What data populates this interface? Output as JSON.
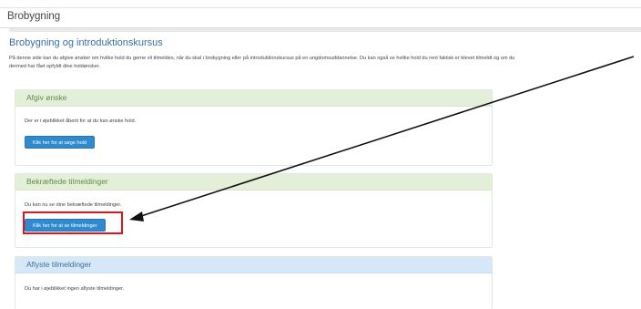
{
  "window": {
    "title": "Brobygning"
  },
  "page": {
    "title": "Brobygning og introduktionskursus",
    "intro": "På denne side kan du afgive ønsker om hvilke hold du gerne vil tilmeldes, når du skal i brobygning eller på introduktionskursus på en ungdomsuddannelse. Du kan også se hvilke hold du rent faktisk er blevet tilmeldt og om du dermed har fået opfyldt dine holdønsker."
  },
  "panels": [
    {
      "heading": "Afgiv ønske",
      "text": "Der er i øjeblikket åbent for at du kan ønske hold.",
      "button": "Klik her for at søge hold"
    },
    {
      "heading": "Bekræftede tilmeldinger",
      "text": "Du kan nu se dine bekræftede tilmeldinger.",
      "button": "Klik her for at se tilmeldinger"
    },
    {
      "heading": "Aflyste tilmeldinger",
      "text": "Du har i øjeblikket ingen aflyste tilmeldinger."
    }
  ],
  "colors": {
    "accent_button": "#2f8ad0",
    "green_heading": "#e3efd9",
    "blue_heading": "#d6e8f8",
    "highlight": "#e0151c"
  }
}
